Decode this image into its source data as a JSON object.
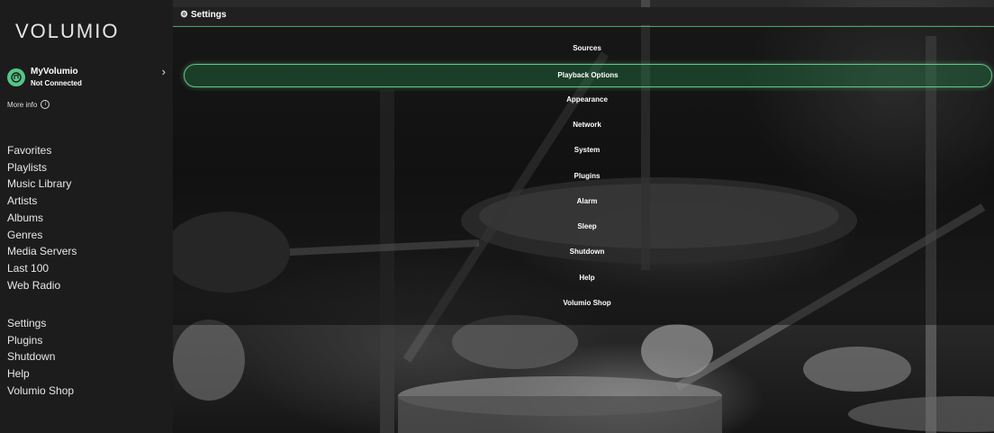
{
  "brand": {
    "logo_text": "VOLUMIO",
    "accent": "#54c688"
  },
  "account": {
    "name": "MyVolumio",
    "status": "Not Connected",
    "more_info": "More info"
  },
  "sidebar": {
    "browse_items": [
      {
        "label": "Favorites"
      },
      {
        "label": "Playlists"
      },
      {
        "label": "Music Library"
      },
      {
        "label": "Artists"
      },
      {
        "label": "Albums"
      },
      {
        "label": "Genres"
      },
      {
        "label": "Media Servers"
      },
      {
        "label": "Last 100"
      },
      {
        "label": "Web Radio"
      }
    ],
    "system_items": [
      {
        "label": "Settings"
      },
      {
        "label": "Plugins"
      },
      {
        "label": "Shutdown"
      },
      {
        "label": "Help"
      },
      {
        "label": "Volumio Shop"
      }
    ]
  },
  "header": {
    "title": "Settings",
    "icon": "gear-icon"
  },
  "settings_menu": {
    "active": "Playback Options",
    "items": [
      {
        "label": "Sources"
      },
      {
        "label": "Playback Options"
      },
      {
        "label": "Appearance"
      },
      {
        "label": "Network"
      },
      {
        "label": "System"
      },
      {
        "label": "Plugins"
      },
      {
        "label": "Alarm"
      },
      {
        "label": "Sleep"
      },
      {
        "label": "Shutdown"
      },
      {
        "label": "Help"
      },
      {
        "label": "Volumio Shop"
      }
    ]
  }
}
